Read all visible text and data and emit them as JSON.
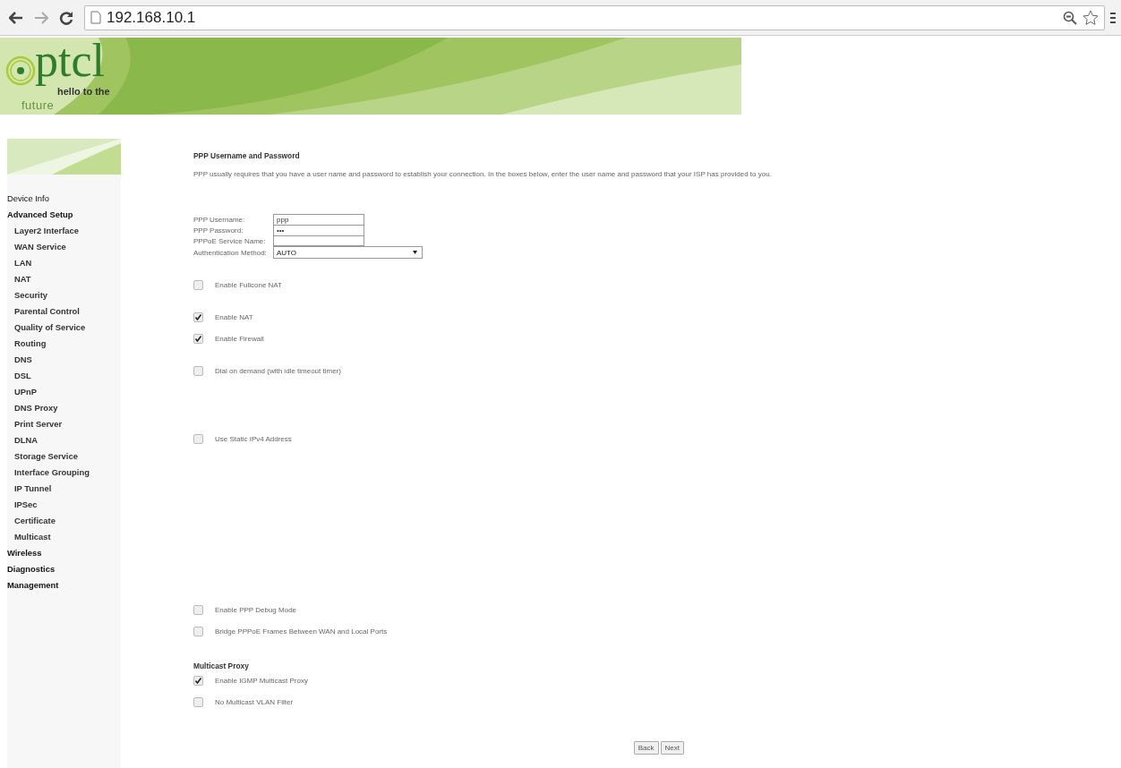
{
  "browser": {
    "address": "192.168.10.1"
  },
  "logo": {
    "brand": "ptcl",
    "tagline_1": "hello to the",
    "tagline_2": "future"
  },
  "sidebar": {
    "items": [
      {
        "label": "Device Info"
      },
      {
        "label": "Advanced Setup",
        "children": [
          {
            "label": "Layer2 Interface"
          },
          {
            "label": "WAN Service"
          },
          {
            "label": "LAN"
          },
          {
            "label": "NAT"
          },
          {
            "label": "Security"
          },
          {
            "label": "Parental Control"
          },
          {
            "label": "Quality of Service"
          },
          {
            "label": "Routing"
          },
          {
            "label": "DNS"
          },
          {
            "label": "DSL"
          },
          {
            "label": "UPnP"
          },
          {
            "label": "DNS Proxy"
          },
          {
            "label": "Print Server"
          },
          {
            "label": "DLNA"
          },
          {
            "label": "Storage Service"
          },
          {
            "label": "Interface Grouping"
          },
          {
            "label": "IP Tunnel"
          },
          {
            "label": "IPSec"
          },
          {
            "label": "Certificate"
          },
          {
            "label": "Multicast"
          }
        ]
      },
      {
        "label": "Wireless"
      },
      {
        "label": "Diagnostics"
      },
      {
        "label": "Management"
      }
    ]
  },
  "form": {
    "title": "PPP Username and Password",
    "description": "PPP usually requires that you have a user name and password to establish your connection. In the boxes below, enter the user name and password that your ISP has provided to you.",
    "fields": [
      {
        "label": "PPP Username:",
        "kind": "text",
        "value": "ppp"
      },
      {
        "label": "PPP Password:",
        "kind": "text",
        "value": "•••"
      },
      {
        "label": "PPPoE Service Name:",
        "kind": "text"
      },
      {
        "label": "Authentication Method:",
        "kind": "select",
        "value": "AUTO"
      }
    ],
    "options": [
      {
        "label": "Enable Fullcone NAT",
        "checked": false
      },
      {
        "label": "Enable NAT",
        "checked": true
      },
      {
        "label": "Enable Firewall",
        "checked": true
      },
      {
        "label": "Dial on demand (with idle timeout timer)",
        "checked": false
      },
      {
        "label": "Use Static IPv4 Address",
        "checked": false
      },
      {
        "label": "Enable PPP Debug Mode",
        "checked": false
      },
      {
        "label": "Bridge PPPoE Frames Between WAN and Local Ports",
        "checked": false
      }
    ],
    "multicast_title": "Multicast Proxy",
    "multicast_options": [
      {
        "label": "Enable IGMP Multicast Proxy",
        "checked": true
      },
      {
        "label": "No Multicast VLAN Filter",
        "checked": false
      }
    ],
    "buttons": [
      "Back",
      "Next"
    ]
  }
}
